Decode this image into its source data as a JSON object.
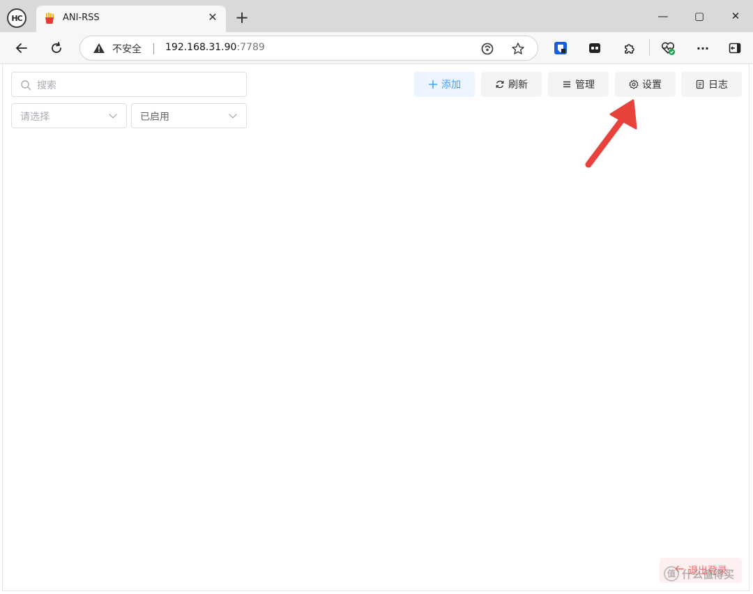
{
  "browser": {
    "profile_initials": "HC",
    "tab": {
      "title": "ANI-RSS",
      "favicon": "fries-icon"
    },
    "new_tab_label": "+",
    "window_controls": {
      "minimize": "—",
      "maximize": "▢",
      "close": "✕"
    },
    "address_bar": {
      "security_label": "不安全",
      "host": "192.168.31.90",
      "port": ":7789"
    },
    "extensions": [
      "bitwarden-icon",
      "tab-manager-icon",
      "extensions-puzzle-icon",
      "health-monitor-icon"
    ],
    "menu_label": "···"
  },
  "page": {
    "search": {
      "placeholder": "搜索"
    },
    "filter_select": {
      "placeholder": "请选择"
    },
    "status_select": {
      "value": "已启用"
    },
    "buttons": {
      "add": "添加",
      "refresh": "刷新",
      "manage": "管理",
      "settings": "设置",
      "log": "日志"
    },
    "logout": "退出登录"
  },
  "watermark": {
    "badge": "值",
    "text": "什么值得买"
  },
  "colors": {
    "primary": "#409eff",
    "danger": "#f56c6c",
    "annotation_arrow": "#e8423c"
  }
}
